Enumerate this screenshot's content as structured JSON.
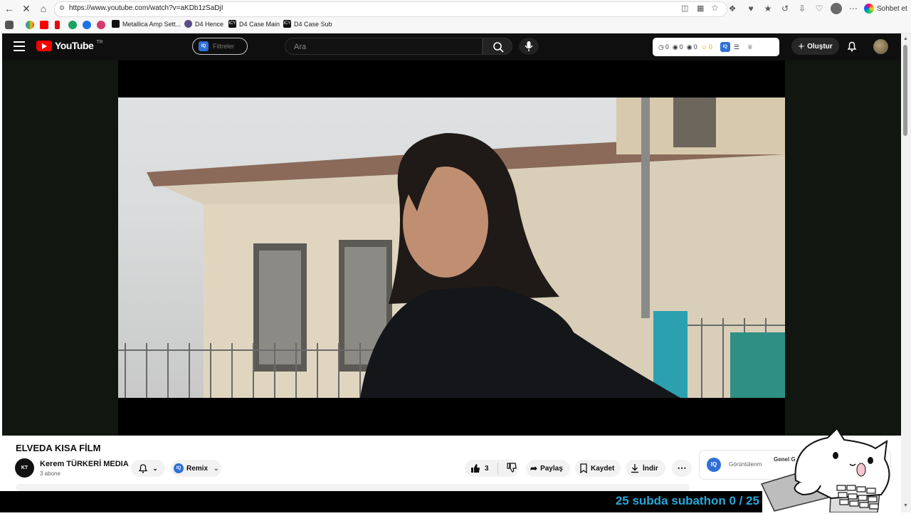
{
  "browser": {
    "url": "https://www.youtube.com/watch?v=aKDb1zSaDjI",
    "chat_label": "Sohbet et",
    "bookmarks": [
      {
        "label": "Metallica Amp Sett..."
      },
      {
        "label": "D4 Hence"
      },
      {
        "label": "D4 Case Main"
      },
      {
        "label": "D4 Case Sub"
      }
    ]
  },
  "masthead": {
    "logo_text": "YouTube",
    "region": "TR",
    "filter_label": "Filtreler",
    "search_placeholder": "Ara",
    "stats": [
      "0",
      "0",
      "0",
      "0"
    ],
    "create_label": "Oluştur"
  },
  "video": {
    "title": "ELVEDA KISA FİLM",
    "channel_name": "Kerem TÜRKERİ MEDIA",
    "subscribers": "3 abone",
    "remix_label": "Remix",
    "like_count": "3",
    "share_label": "Paylaş",
    "save_label": "Kaydet",
    "download_label": "İndir"
  },
  "side_panel": {
    "label": "Görüntülenm",
    "button": "Genel G"
  },
  "overlay": {
    "subathon_text": "25 subda subathon 0 / 25"
  },
  "colors": {
    "youtube_red": "#ff0000",
    "masthead_bg": "#0f0f0f",
    "subathon_text": "#2aa6d8",
    "iq_blue": "#2f6fd6"
  }
}
